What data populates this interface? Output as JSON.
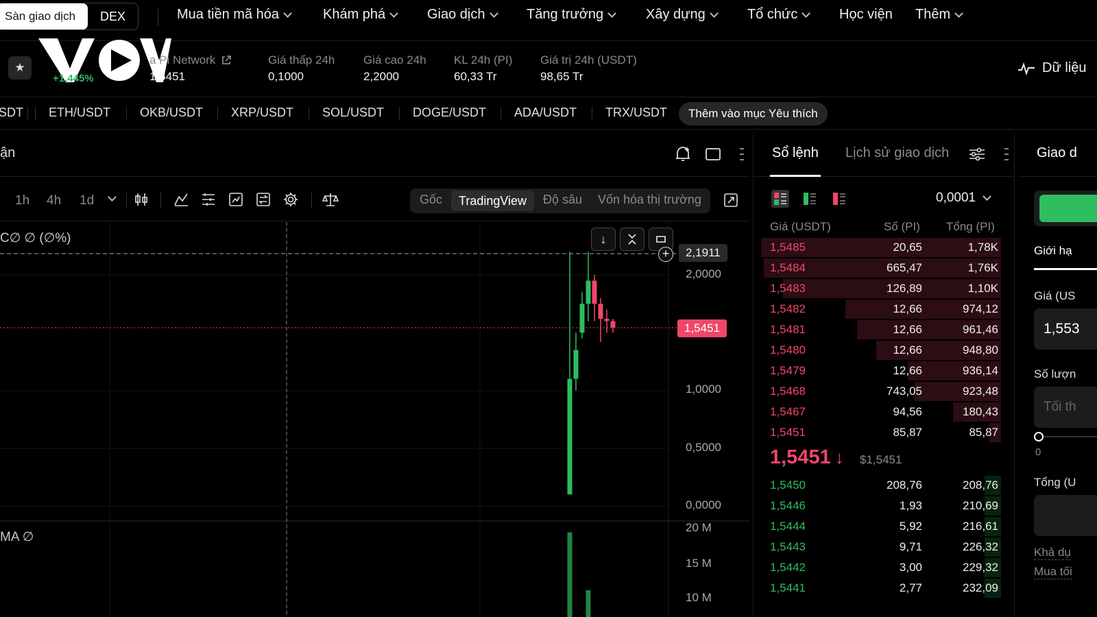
{
  "nav": {
    "segment_exchange": "Sàn giao dịch",
    "segment_dex": "DEX",
    "items": [
      {
        "label": "Mua tiền mã hóa",
        "dropdown": true
      },
      {
        "label": "Khám phá",
        "dropdown": true
      },
      {
        "label": "Giao dịch",
        "dropdown": true
      },
      {
        "label": "Tăng trưởng",
        "dropdown": true
      },
      {
        "label": "Xây dựng",
        "dropdown": true
      },
      {
        "label": "Tổ chức",
        "dropdown": true
      },
      {
        "label": "Học viện",
        "dropdown": false
      },
      {
        "label": "Thêm",
        "dropdown": true
      }
    ]
  },
  "ticker": {
    "logo_text": "VOV",
    "change": "+1,445%",
    "name_label": "a Pi Network",
    "price": "1,5451",
    "stats": [
      {
        "label": "Giá thấp 24h",
        "value": "0,1000"
      },
      {
        "label": "Giá cao 24h",
        "value": "2,2000"
      },
      {
        "label": "KL 24h (PI)",
        "value": "60,33 Tr"
      },
      {
        "label": "Giá trị 24h (USDT)",
        "value": "98,65 Tr"
      }
    ],
    "data_link": "Dữ liệu"
  },
  "pairs": {
    "items": [
      "SDT",
      "ETH/USDT",
      "OKB/USDT",
      "XRP/USDT",
      "SOL/USDT",
      "DOGE/USDT",
      "ADA/USDT",
      "TRX/USDT"
    ],
    "add_favorite": "Thêm vào mục Yêu thích"
  },
  "chart": {
    "header_text": "ận",
    "timeframes": [
      "1h",
      "4h",
      "1d"
    ],
    "views": [
      "Gốc",
      "TradingView",
      "Độ sâu",
      "Vốn hóa thị trường"
    ],
    "active_view": "TradingView",
    "ohlc_legend": "C∅ ∅ (∅%)",
    "volume_legend": "MA ∅",
    "crosshair_price": "2,1911",
    "last_price_tag": "1,5451",
    "y_ticks": [
      "2,0000",
      "1,0000",
      "0,5000",
      "0,0000"
    ],
    "vol_ticks": [
      "20 M",
      "15 M",
      "10 M"
    ],
    "up_color": "#2ebd5f",
    "down_color": "#f0466a"
  },
  "orderbook": {
    "tab_active": "Sổ lệnh",
    "tab_trades": "Lịch sử giao dịch",
    "precision": "0,0001",
    "col_price": "Giá (USDT)",
    "col_size": "Số (PI)",
    "col_total": "Tổng (PI)",
    "asks": [
      {
        "price": "1,5485",
        "size": "20,65",
        "total": "1,78K",
        "depth": 1.0
      },
      {
        "price": "1,5484",
        "size": "665,47",
        "total": "1,76K",
        "depth": 0.99
      },
      {
        "price": "1,5483",
        "size": "126,89",
        "total": "1,10K",
        "depth": 0.91
      },
      {
        "price": "1,5482",
        "size": "12,66",
        "total": "974,12",
        "depth": 0.65
      },
      {
        "price": "1,5481",
        "size": "12,66",
        "total": "961,46",
        "depth": 0.6
      },
      {
        "price": "1,5480",
        "size": "12,66",
        "total": "948,80",
        "depth": 0.52
      },
      {
        "price": "1,5479",
        "size": "12,66",
        "total": "936,14",
        "depth": 0.39
      },
      {
        "price": "1,5468",
        "size": "743,05",
        "total": "923,48",
        "depth": 0.36
      },
      {
        "price": "1,5467",
        "size": "94,56",
        "total": "180,43",
        "depth": 0.2
      },
      {
        "price": "1,5451",
        "size": "85,87",
        "total": "85,87",
        "depth": 0.05
      }
    ],
    "last_price": "1,5451",
    "last_price_usd": "$1,5451",
    "bids": [
      {
        "price": "1,5450",
        "size": "208,76",
        "total": "208,76",
        "depth": 0.07
      },
      {
        "price": "1,5446",
        "size": "1,93",
        "total": "210,69",
        "depth": 0.07
      },
      {
        "price": "1,5444",
        "size": "5,92",
        "total": "216,61",
        "depth": 0.07
      },
      {
        "price": "1,5443",
        "size": "9,71",
        "total": "226,32",
        "depth": 0.07
      },
      {
        "price": "1,5442",
        "size": "3,00",
        "total": "229,32",
        "depth": 0.07
      },
      {
        "price": "1,5441",
        "size": "2,77",
        "total": "232,09",
        "depth": 0.07
      }
    ]
  },
  "trade": {
    "title": "Giao d",
    "order_type": "Giới hạ",
    "price_label": "Giá (US",
    "price_value": "1,553",
    "qty_label": "Số lượn",
    "qty_placeholder": "Tối th",
    "slider_min": "0",
    "total_label": "Tổng (U",
    "available_label": "Khả dụ",
    "max_buy_label": "Mua tối",
    "buy_color": "#2ebd5f"
  }
}
